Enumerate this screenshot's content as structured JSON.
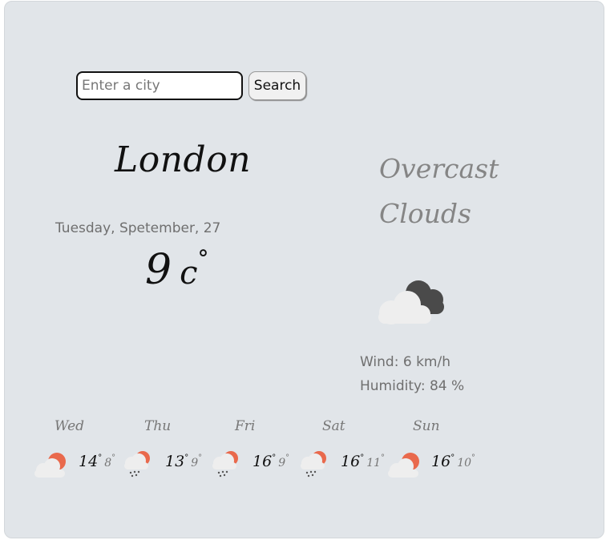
{
  "search": {
    "placeholder": "Enter a city",
    "button_label": "Search"
  },
  "current": {
    "city": "London",
    "date": "Tuesday, Spetember, 27",
    "temperature": "9",
    "unit": "c",
    "degree_symbol": "°",
    "description": "Overcast Clouds",
    "icon": "overcast-clouds-icon",
    "wind": "Wind: 6 km/h",
    "humidity": "Humidity: 84 %"
  },
  "forecast": [
    {
      "day": "Wed",
      "max": "14",
      "min": "8",
      "icon": "sun-behind-cloud-icon"
    },
    {
      "day": "Thu",
      "max": "13",
      "min": "9",
      "icon": "sun-behind-rain-cloud-icon"
    },
    {
      "day": "Fri",
      "max": "16",
      "min": "9",
      "icon": "sun-behind-rain-cloud-icon"
    },
    {
      "day": "Sat",
      "max": "16",
      "min": "11",
      "icon": "sun-behind-rain-cloud-icon"
    },
    {
      "day": "Sun",
      "max": "16",
      "min": "10",
      "icon": "sun-behind-cloud-icon"
    }
  ],
  "colors": {
    "background": "#e1e5e9",
    "sun": "#e9694c",
    "cloud": "#eeeeee",
    "dark_cloud": "#4a4a4a"
  }
}
